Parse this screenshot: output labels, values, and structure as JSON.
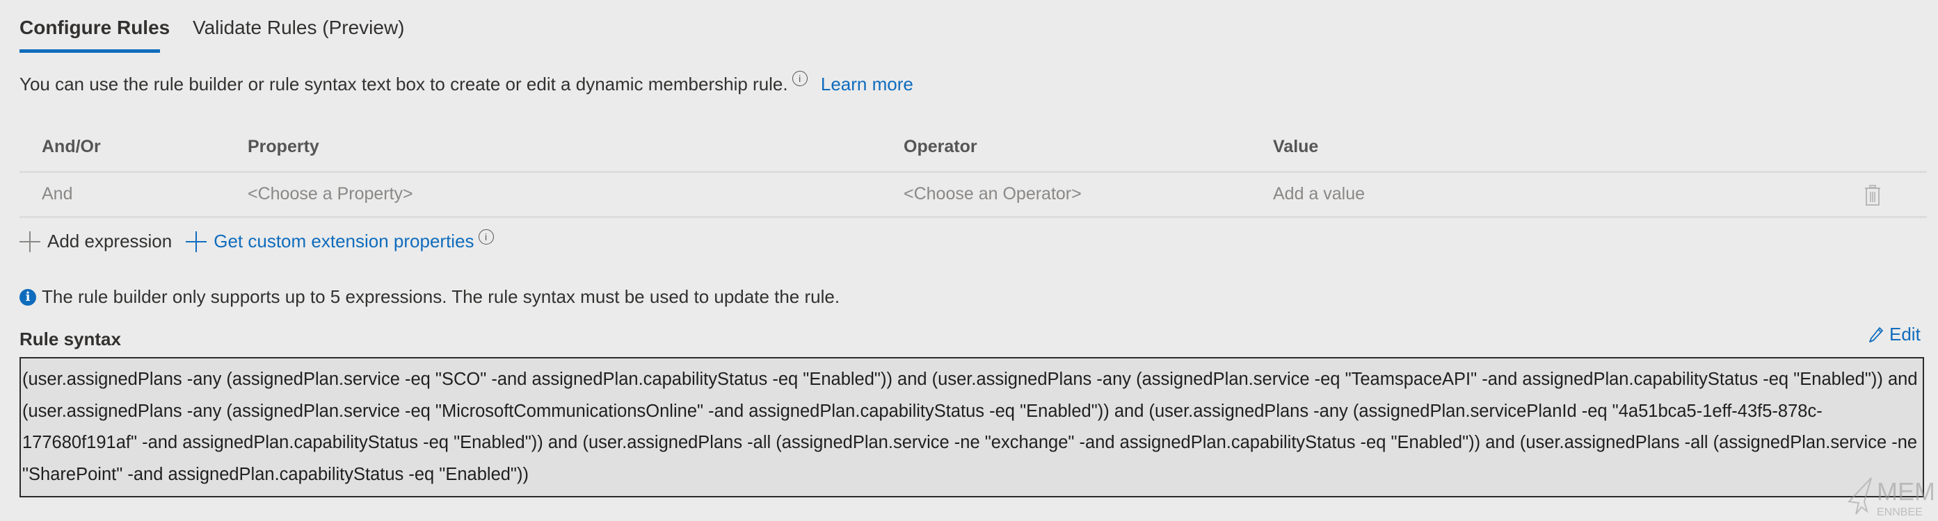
{
  "tabs": [
    {
      "label": "Configure Rules",
      "active": true
    },
    {
      "label": "Validate Rules (Preview)",
      "active": false
    }
  ],
  "description": {
    "text": "You can use the rule builder or rule syntax text box to create or edit a dynamic membership rule.",
    "info_icon": "info-circle-icon",
    "learn_more": "Learn more"
  },
  "table": {
    "columns": [
      "And/Or",
      "Property",
      "Operator",
      "Value"
    ],
    "rows": [
      {
        "and_or": "And",
        "property": "<Choose a Property>",
        "operator": "<Choose an Operator>",
        "value": "Add a value",
        "action_icon": "trash-icon"
      }
    ]
  },
  "actions": {
    "add_expression": "Add expression",
    "custom_extension": "Get custom extension properties"
  },
  "info_message": "The rule builder only supports up to 5 expressions. The rule syntax must be used to update the rule.",
  "rule_syntax": {
    "label": "Rule syntax",
    "edit_label": "Edit",
    "value": "(user.assignedPlans -any (assignedPlan.service -eq \"SCO\" -and assignedPlan.capabilityStatus -eq \"Enabled\")) and (user.assignedPlans -any (assignedPlan.service -eq \"TeamspaceAPI\" -and assignedPlan.capabilityStatus -eq \"Enabled\")) and (user.assignedPlans -any (assignedPlan.service -eq \"MicrosoftCommunicationsOnline\" -and assignedPlan.capabilityStatus -eq \"Enabled\")) and (user.assignedPlans -any (assignedPlan.servicePlanId -eq \"4a51bca5-1eff-43f5-878c-177680f191af\" -and assignedPlan.capabilityStatus -eq \"Enabled\")) and (user.assignedPlans -all (assignedPlan.service -ne \"exchange\" -and assignedPlan.capabilityStatus -eq \"Enabled\")) and (user.assignedPlans -all (assignedPlan.service -ne \"SharePoint\" -and assignedPlan.capabilityStatus -eq \"Enabled\"))"
  },
  "watermark": {
    "line1": "MEM",
    "line2": "ENNBEE"
  },
  "colors": {
    "accent": "#0f6cbd",
    "background": "#ebebeb",
    "textbox_bg": "#e0e0e0"
  }
}
